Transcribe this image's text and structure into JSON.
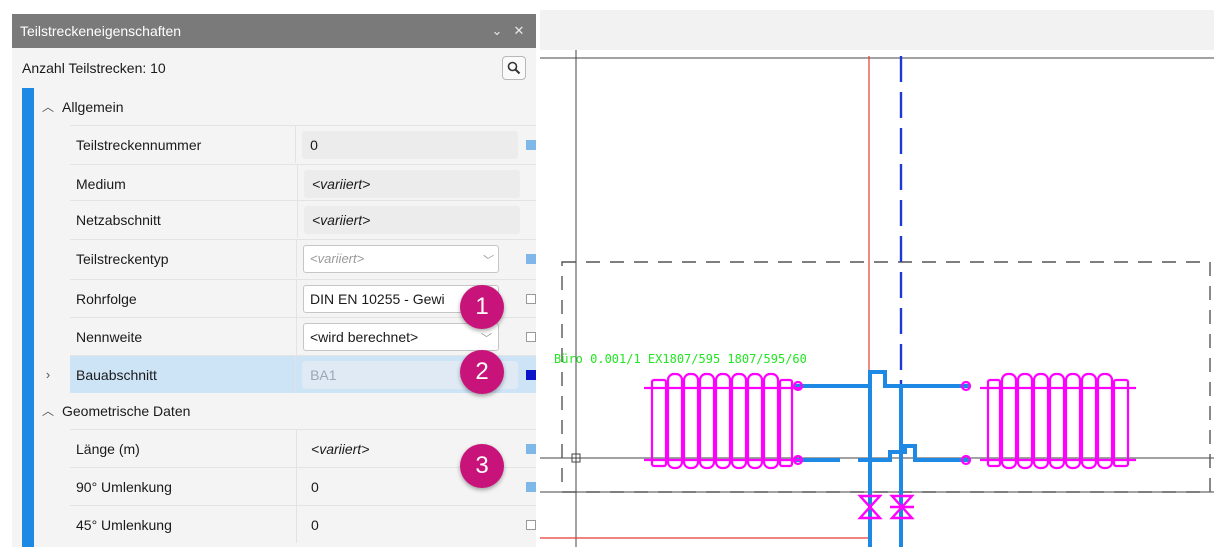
{
  "panel": {
    "title": "Teilstreckeneigenschaften",
    "pin_glyph": "⌄",
    "close_glyph": "✕",
    "count_label": "Anzahl Teilstrecken: 10"
  },
  "sections": {
    "general": "Allgemein",
    "geometry": "Geometrische Daten"
  },
  "rows": {
    "teilstreckennummer": {
      "name": "Teilstreckennummer",
      "value": "0"
    },
    "medium": {
      "name": "Medium",
      "value": "<variiert>"
    },
    "netzabschnitt": {
      "name": "Netzabschnitt",
      "value": "<variiert>"
    },
    "teilstreckentyp": {
      "name": "Teilstreckentyp",
      "value": "<variiert>"
    },
    "rohrfolge": {
      "name": "Rohrfolge",
      "value": "DIN EN 10255 - Gewi"
    },
    "nennweite": {
      "name": "Nennweite",
      "value": "<wird berechnet>"
    },
    "bauabschnitt": {
      "name": "Bauabschnitt",
      "value": "BA1"
    },
    "laenge": {
      "name": "Länge (m)",
      "value": "<variiert>"
    },
    "umlenkung90": {
      "name": "90° Umlenkung",
      "value": "0"
    },
    "umlenkung45": {
      "name": "45° Umlenkung",
      "value": "0"
    }
  },
  "badges": {
    "one": "1",
    "two": "2",
    "three": "3"
  },
  "cad": {
    "room_label": "Büro 0.001/1 EX1807/595 1807/595/60"
  },
  "colors": {
    "accent": "#1e88e5",
    "badge": "#c8137a",
    "radiator": "#ff00ff",
    "pipe": "#1e88e5",
    "label_green": "#22e622"
  },
  "icons": {
    "search": "search-icon",
    "chevron_up": "chevron-up-icon",
    "chevron_right": "chevron-right-icon",
    "dropdown": "chevron-down-icon"
  }
}
